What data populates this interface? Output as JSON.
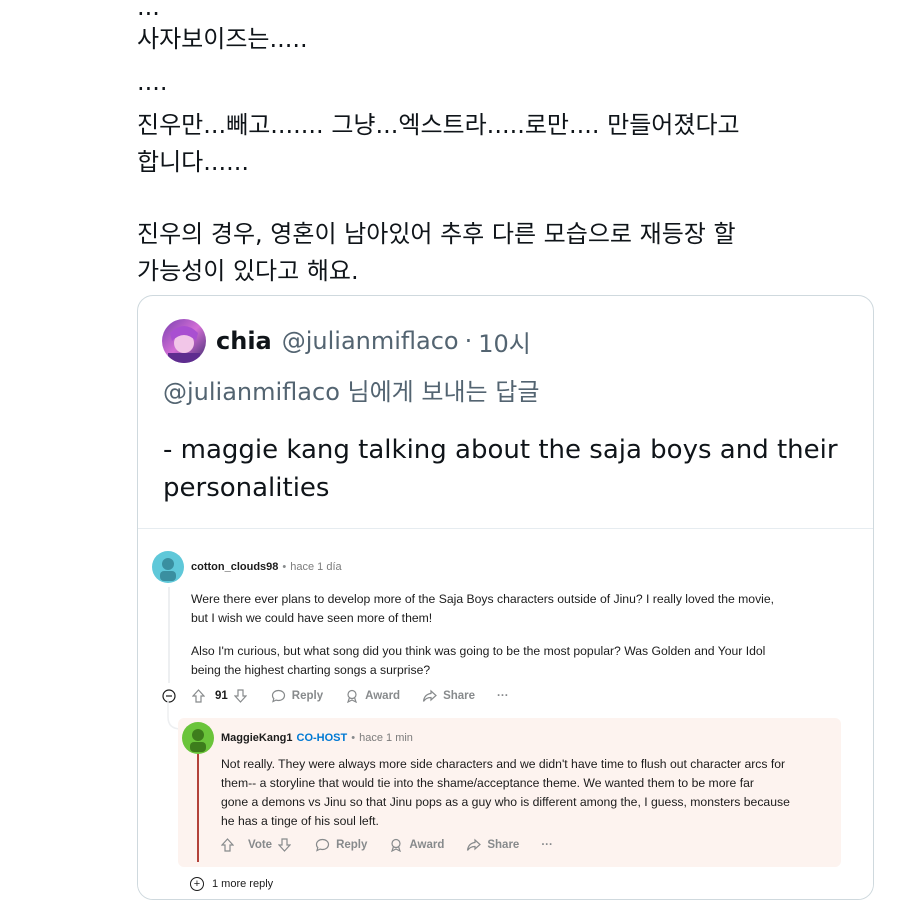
{
  "tweet": {
    "lines": [
      "...",
      "사자보이즈는.....",
      "....",
      "진우만...빼고....... 그냥...엑스트라.....로만.... 만들어졌다고",
      "합니다......",
      "",
      "진우의 경우, 영혼이 남아있어 추후 다른 모습으로 재등장 할",
      "가능성이 있다고 해요."
    ]
  },
  "quote": {
    "name": "chia",
    "handle": "@julianmiflaco",
    "dot": "·",
    "time": "10시",
    "reply_to": "@julianmiflaco 님에게 보내는 답글",
    "body_lines": [
      "- maggie kang talking about the saja boys and their",
      "personalities"
    ]
  },
  "reddit": {
    "comment": {
      "author": "cotton_clouds98",
      "sep": "•",
      "time": "hace 1 día",
      "lines": [
        "Were there ever plans to develop more of the Saja Boys characters outside of Jinu? I really loved the movie,",
        "but I wish we could have seen more of them!",
        "",
        "Also I'm curious, but what song did you think was going to be the most popular? Was Golden and Your Idol",
        "being the highest charting songs a surprise?"
      ],
      "votes": "91",
      "reply_label": "Reply",
      "award_label": "Award",
      "share_label": "Share",
      "more_label": "···"
    },
    "reply": {
      "author": "MaggieKang1",
      "badge": "CO-HOST",
      "sep": "•",
      "time": "hace 1 min",
      "lines": [
        "Not really. They were always more side characters and we didn't have time to flush out character arcs for",
        "them-- a storyline that would tie into the shame/acceptance theme. We wanted them to be more far",
        "gone a demons vs Jinu so that Jinu pops as a guy who is different among the, I guess, monsters because",
        "he has a tinge of his soul left."
      ],
      "vote_label": "Vote",
      "reply_label": "Reply",
      "award_label": "Award",
      "share_label": "Share",
      "more_label": "···"
    },
    "more_replies": "1 more reply",
    "more_replies_icon": "+"
  },
  "colors": {
    "text": "#0f1419",
    "secondary": "#536471",
    "cohost": "#0079d3",
    "reply_bg": "#fdf3ef",
    "thread_accent": "#b3423a",
    "avatar_teal": "#5fc8d9",
    "avatar_green": "#6ac43a"
  },
  "icons": {
    "upvote": "upvote-arrow-icon",
    "downvote": "downvote-arrow-icon",
    "reply": "speech-bubble-icon",
    "award": "award-ribbon-icon",
    "share": "share-arrow-icon",
    "collapse": "minus-circle-icon"
  }
}
